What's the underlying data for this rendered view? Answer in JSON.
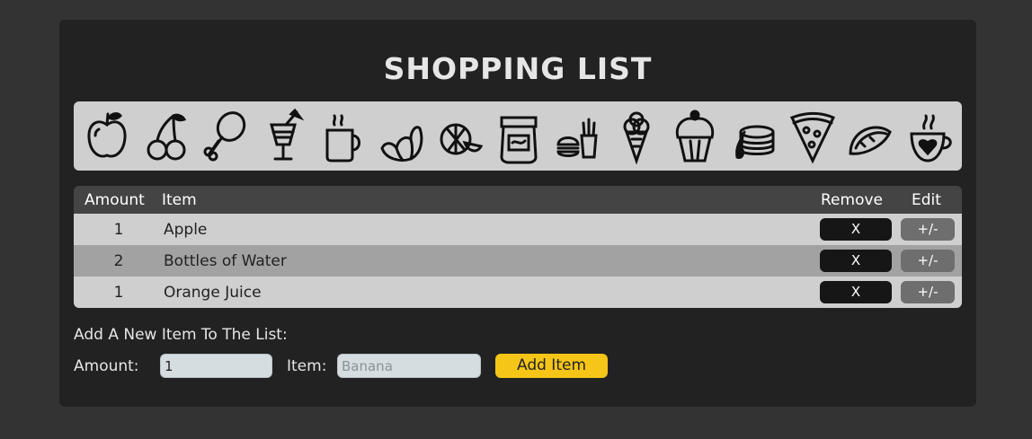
{
  "title": "SHOPPING LIST",
  "icons": [
    "apple-icon",
    "cherries-icon",
    "drumstick-icon",
    "cocktail-icon",
    "coffee-mug-icon",
    "croissant-icon",
    "watermelon-icon",
    "jam-jar-icon",
    "burger-fries-icon",
    "ice-cream-icon",
    "cupcake-icon",
    "pancakes-icon",
    "pizza-slice-icon",
    "taco-icon",
    "heart-coffee-cup-icon"
  ],
  "table": {
    "headers": {
      "amount": "Amount",
      "item": "Item",
      "remove": "Remove",
      "edit": "Edit"
    },
    "rows": [
      {
        "amount": "1",
        "item": "Apple",
        "remove": "X",
        "edit": "+/-"
      },
      {
        "amount": "2",
        "item": "Bottles of Water",
        "remove": "X",
        "edit": "+/-"
      },
      {
        "amount": "1",
        "item": "Orange Juice",
        "remove": "X",
        "edit": "+/-"
      }
    ]
  },
  "form": {
    "heading": "Add A New Item To The List:",
    "amount_label": "Amount:",
    "amount_value": "1",
    "item_label": "Item:",
    "item_placeholder": "Banana",
    "add_label": "Add Item"
  },
  "colors": {
    "page_bg": "#333333",
    "card_bg": "#222222",
    "strip_bg": "#cfcfcf",
    "accent": "#f5c518"
  }
}
